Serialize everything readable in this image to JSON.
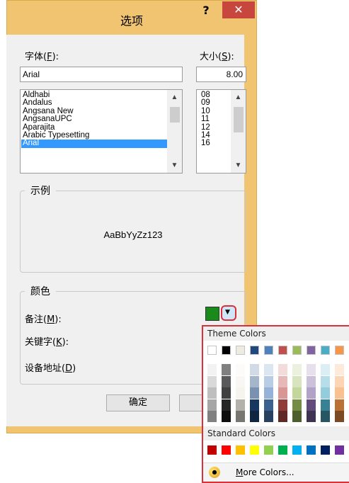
{
  "dialog": {
    "title": "选项",
    "help_label": "?",
    "close_label": "✕"
  },
  "font": {
    "label_prefix": "字体(",
    "label_key": "F",
    "label_suffix": "):",
    "value": "Arial",
    "items": [
      "Aldhabi",
      "Andalus",
      "Angsana New",
      "AngsanaUPC",
      "Aparajita",
      "Arabic Typesetting",
      "Arial"
    ],
    "selected_index": 6
  },
  "size": {
    "label_prefix": "大小(",
    "label_key": "S",
    "label_suffix": "):",
    "value": "8.00",
    "items": [
      "08",
      "09",
      "10",
      "11",
      "12",
      "14",
      "16"
    ]
  },
  "sample": {
    "legend": "示例",
    "text": "AaBbYyZz123"
  },
  "color": {
    "legend": "颜色",
    "note_prefix": "备注(",
    "note_key": "M",
    "note_suffix": "):",
    "keyword_prefix": "关键字(",
    "keyword_key": "K",
    "keyword_suffix": "):",
    "address_prefix": "设备地址(",
    "address_key": "D",
    "address_suffix": ")",
    "note_color": "#1a8a1a"
  },
  "buttons": {
    "ok": "确定",
    "cancel": "取"
  },
  "popup": {
    "theme_title": "Theme Colors",
    "standard_title": "Standard Colors",
    "more_colors_key": "M",
    "more_colors_rest": "ore Colors...",
    "theme_top": [
      "#ffffff",
      "#000000",
      "#eeece1",
      "#1f497d",
      "#4f81bd",
      "#c0504d",
      "#9bbb59",
      "#8064a2",
      "#4bacc6",
      "#f79646"
    ],
    "standard": [
      "#c00000",
      "#ff0000",
      "#ffc000",
      "#ffff00",
      "#92d050",
      "#00b050",
      "#00b0f0",
      "#0070c0",
      "#002060",
      "#7030a0"
    ]
  }
}
